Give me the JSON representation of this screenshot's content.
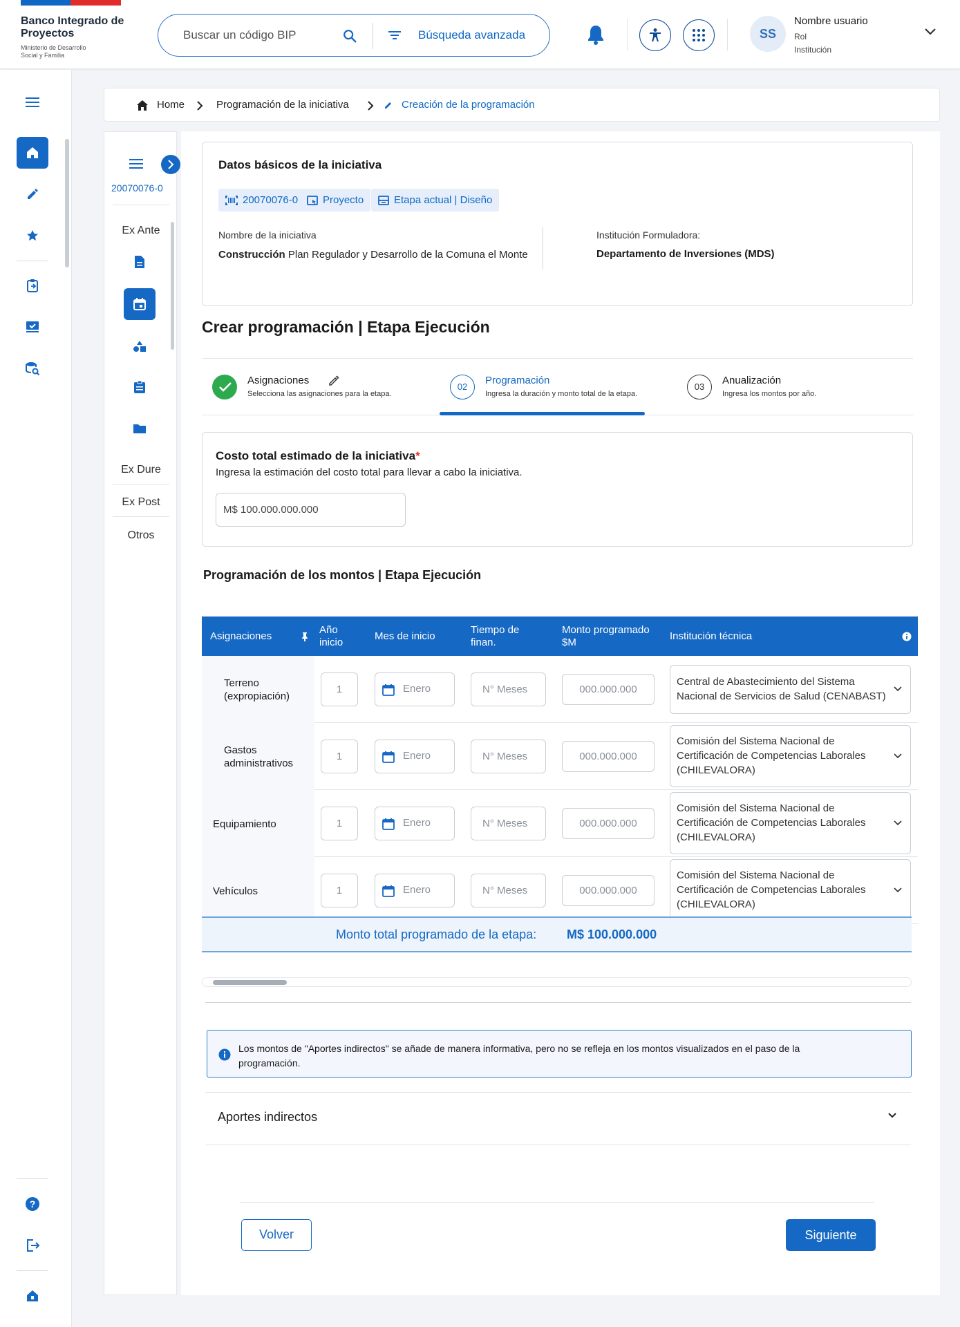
{
  "header": {
    "brand_title": "Banco Integrado de Proyectos",
    "brand_subtitle": "Ministerio de Desarrollo Social y Familia",
    "search_placeholder": "Buscar un código BIP",
    "advanced_search": "Búsqueda avanzada",
    "user_initials": "SS",
    "user_name": "Nombre usuario",
    "user_role": "Rol",
    "user_institution": "Institución",
    "icons": [
      "bell-icon",
      "accessibility-icon",
      "apps-grid-icon",
      "chevron-down-icon"
    ]
  },
  "rail": {
    "icons": [
      "menu-icon",
      "home-icon",
      "edit-icon",
      "star-icon",
      "clipboard-icon",
      "monitor-check-icon",
      "database-search-icon",
      "help-icon",
      "logout-icon",
      "house-lock-icon"
    ],
    "active": "home-icon"
  },
  "breadcrumb": {
    "home": "Home",
    "level2": "Programación de la iniciativa",
    "current": "Creación de la programación"
  },
  "sidebar": {
    "code": "20070076-0",
    "ex_ante": "Ex Ante",
    "ex_dure": "Ex Dure",
    "ex_post": "Ex Post",
    "otros": "Otros",
    "icons": [
      "document-icon",
      "calendar-icon",
      "shapes-icon",
      "clipboard-list-icon",
      "folder-icon"
    ],
    "active": "calendar-icon"
  },
  "basic_data": {
    "title": "Datos básicos de la iniciativa",
    "chips": {
      "code": "20070076-0",
      "type": "Proyecto",
      "stage": "Etapa actual | Diseño"
    },
    "name_label": "Nombre de la iniciativa",
    "name_bold": "Construcción",
    "name_rest": " Plan Regulador y Desarrollo de la Comuna el Monte",
    "institution_label": "Institución Formuladora:",
    "institution_value": "Departamento de Inversiones (MDS)"
  },
  "page_title": "Crear programación | Etapa Ejecución",
  "steps": [
    {
      "num": "",
      "title": "Asignaciones",
      "desc": "Selecciona las asignaciones para la etapa.",
      "state": "done"
    },
    {
      "num": "02",
      "title": "Programación",
      "desc": "Ingresa la duración y monto total de la etapa.",
      "state": "active"
    },
    {
      "num": "03",
      "title": "Anualización",
      "desc": "Ingresa los montos por año.",
      "state": "pending"
    }
  ],
  "cost": {
    "title": "Costo total estimado de la iniciativa",
    "required_mark": "*",
    "description": "Ingresa la estimación del costo total para llevar a cabo la iniciativa.",
    "value": "M$ 100.000.000.000"
  },
  "amounts_title": "Programación de los montos | Etapa Ejecución",
  "table": {
    "headers": {
      "asignaciones": "Asignaciones",
      "anio_1": "Año",
      "anio_2": "inicio",
      "mes": "Mes de inicio",
      "tiempo_1": "Tiempo de",
      "tiempo_2": "finan.",
      "monto_1": "Monto programado",
      "monto_2": "$M",
      "institucion": "Institución técnica"
    },
    "rows": [
      {
        "asig_1": "Terreno",
        "asig_2": "(expropiación)",
        "year": "1",
        "month": "Enero",
        "time": "N° Meses",
        "amount": "000.000.000",
        "inst_1": "Central de Abastecimiento del Sistema",
        "inst_2": "Nacional de Servicios de Salud (CENABAST)",
        "inst_3": ""
      },
      {
        "asig_1": "Gastos",
        "asig_2": "administrativos",
        "year": "1",
        "month": "Enero",
        "time": "N° Meses",
        "amount": "000.000.000",
        "inst_1": "Comisión del Sistema Nacional de",
        "inst_2": "Certificación de Competencias Laborales",
        "inst_3": "(CHILEVALORA)"
      },
      {
        "asig_1": "Equipamiento",
        "asig_2": "",
        "year": "1",
        "month": "Enero",
        "time": "N° Meses",
        "amount": "000.000.000",
        "inst_1": "Comisión del Sistema Nacional de",
        "inst_2": "Certificación de Competencias Laborales",
        "inst_3": "(CHILEVALORA)"
      },
      {
        "asig_1": "Vehículos",
        "asig_2": "",
        "year": "1",
        "month": "Enero",
        "time": "N° Meses",
        "amount": "000.000.000",
        "inst_1": "Comisión del Sistema Nacional de",
        "inst_2": "Certificación de Competencias Laborales",
        "inst_3": "(CHILEVALORA)"
      }
    ],
    "total_label": "Monto total programado de la etapa:",
    "total_value": "M$ 100.000.000"
  },
  "info_text": "Los montos de \"Aportes indirectos\" se añade de manera informativa, pero no se refleja en los montos visualizados en el paso de la programación.",
  "accordion_title": "Aportes indirectos",
  "buttons": {
    "back": "Volver",
    "next": "Siguiente"
  },
  "colors": {
    "primary": "#1568c3",
    "success": "#2eaa4e",
    "required": "#e22c2c"
  }
}
